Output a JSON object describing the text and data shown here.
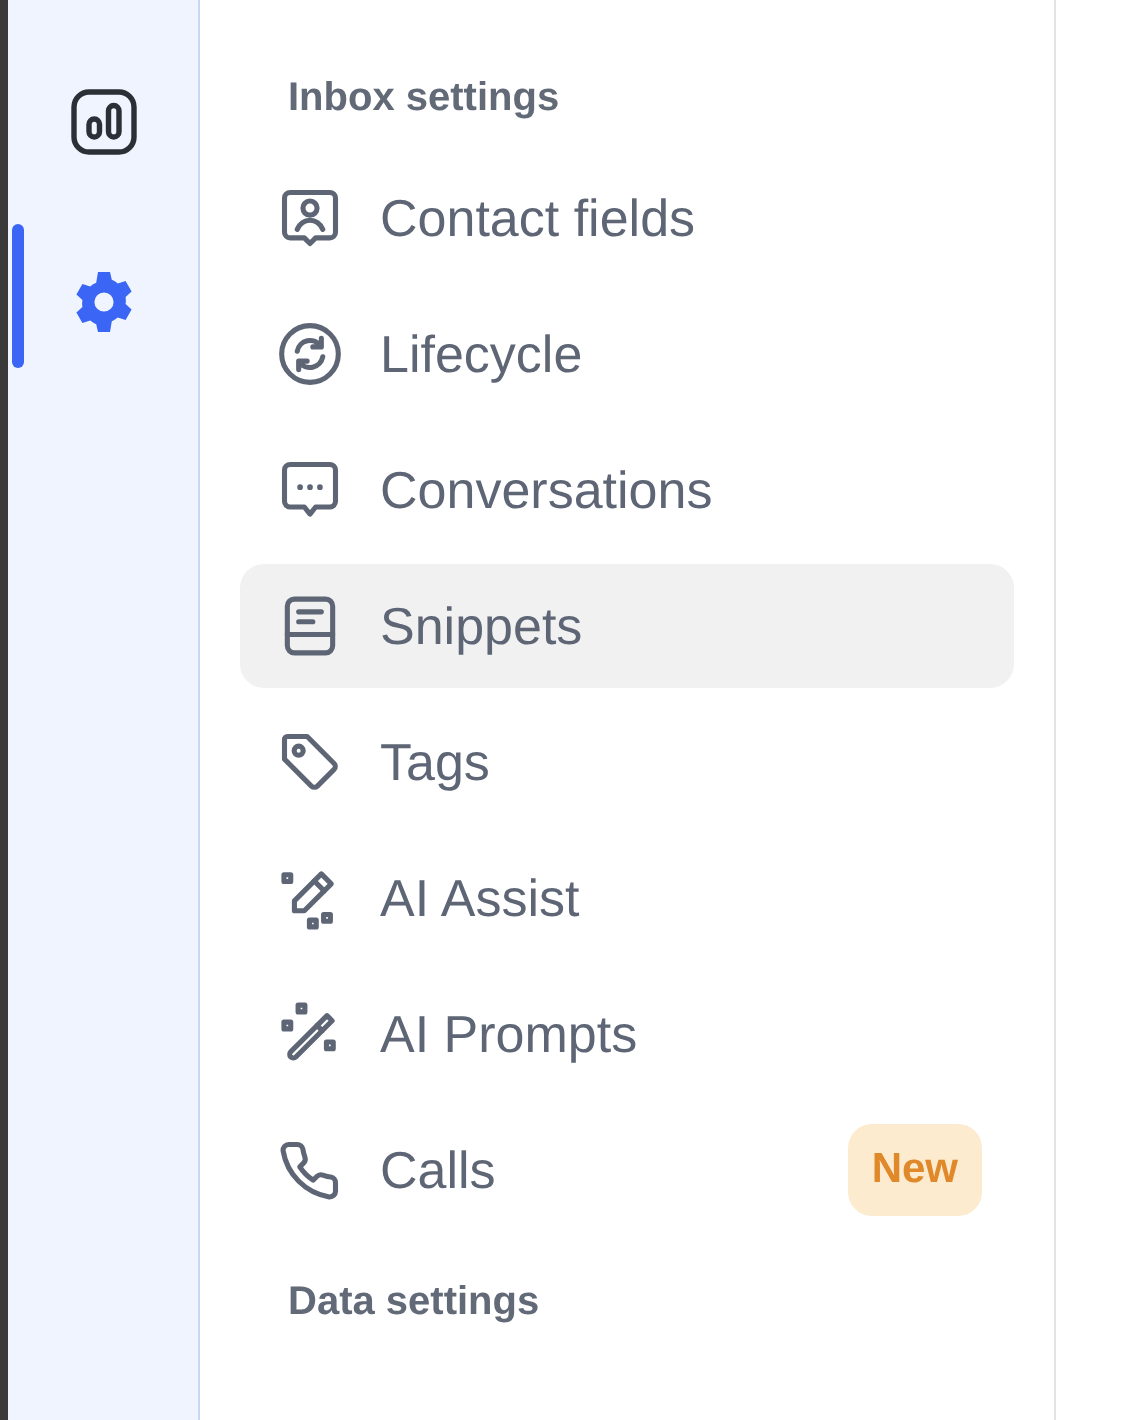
{
  "rail": {
    "items": [
      {
        "kind": "chart",
        "selected": false
      },
      {
        "kind": "gear",
        "selected": true
      }
    ]
  },
  "sections": [
    {
      "title": "Inbox settings",
      "items": [
        {
          "kind": "contact",
          "label": "Contact fields",
          "selected": false
        },
        {
          "kind": "lifecycle",
          "label": "Lifecycle",
          "selected": false
        },
        {
          "kind": "chat",
          "label": "Conversations",
          "selected": false
        },
        {
          "kind": "snippet",
          "label": "Snippets",
          "selected": true
        },
        {
          "kind": "tag",
          "label": "Tags",
          "selected": false
        },
        {
          "kind": "pencil",
          "label": "AI Assist",
          "selected": false
        },
        {
          "kind": "wand",
          "label": "AI Prompts",
          "selected": false
        },
        {
          "kind": "phone",
          "label": "Calls",
          "selected": false,
          "badge": "New"
        }
      ]
    },
    {
      "title": "Data settings"
    }
  ]
}
